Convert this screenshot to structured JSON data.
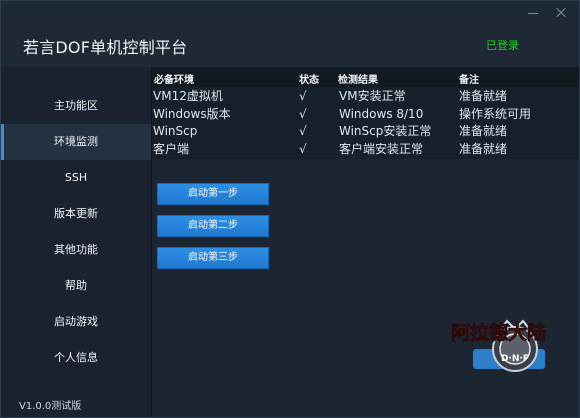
{
  "app": {
    "title": "若言DOF单机控制平台",
    "login_status": "已登录",
    "version": "V1.0.0测试版",
    "logo_text": "阿拉德大陆",
    "logo_sub": "D·N·F"
  },
  "sidebar": {
    "items": [
      {
        "label": "主功能区"
      },
      {
        "label": "环境监测"
      },
      {
        "label": "SSH"
      },
      {
        "label": "版本更新"
      },
      {
        "label": "其他功能"
      },
      {
        "label": "帮助"
      },
      {
        "label": "启动游戏"
      },
      {
        "label": "个人信息"
      }
    ],
    "active": "环境监测"
  },
  "table": {
    "headers": [
      "必备环境",
      "状态",
      "检测结果",
      "备注"
    ],
    "rows": [
      [
        "VM12虚拟机",
        "√",
        "VM安装正常",
        "准备就绪"
      ],
      [
        "Windows版本",
        "√",
        "Windows 8/10",
        "操作系统可用"
      ],
      [
        "WinScp",
        "√",
        "WinScp安装正常",
        "准备就绪"
      ],
      [
        "客户端",
        "√",
        "客户端安装正常",
        "准备就绪"
      ]
    ]
  },
  "buttons": {
    "step1": "启动第一步",
    "step2": "启动第二步",
    "step3": "启动第三步"
  },
  "colors": {
    "accent": "#2f8fe6",
    "login_green": "#1ed21e",
    "background": "#1c2633"
  }
}
